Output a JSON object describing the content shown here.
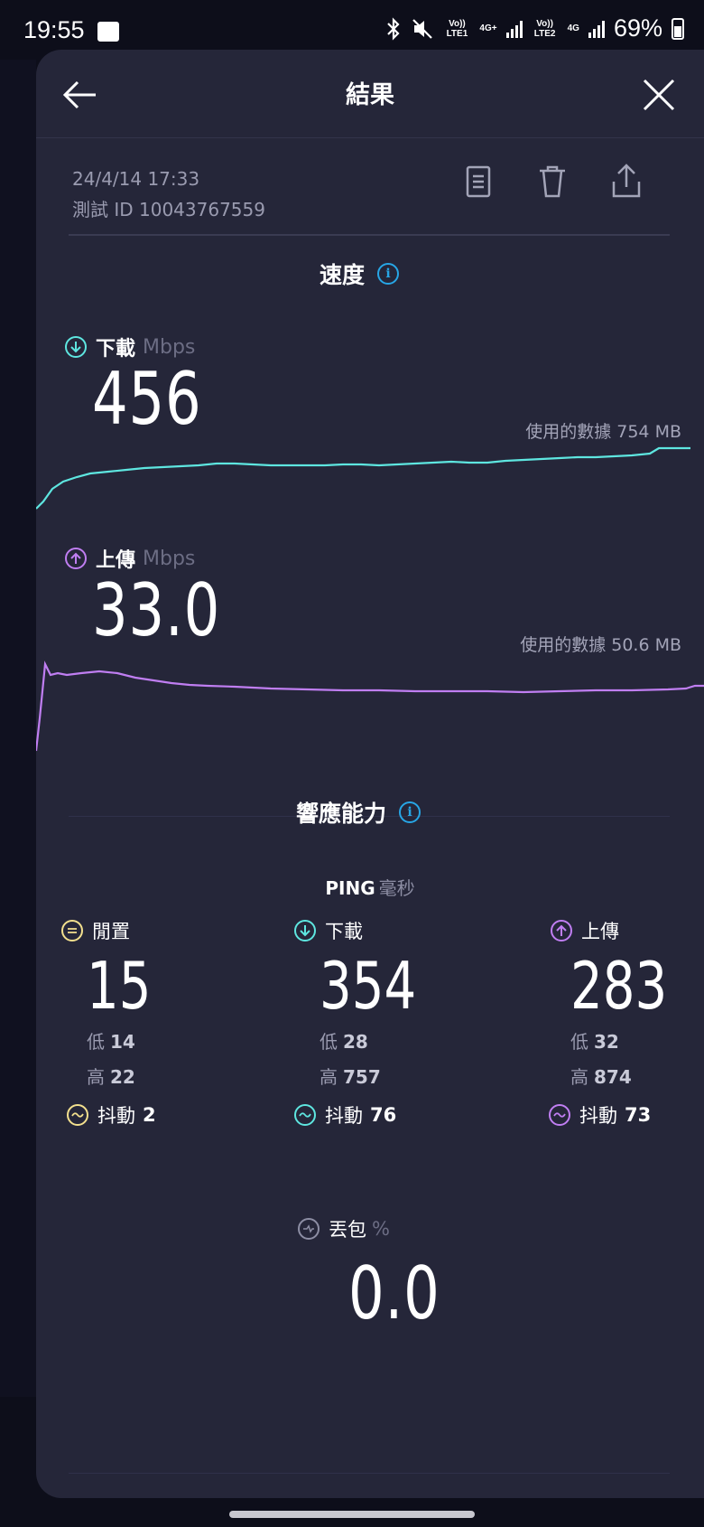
{
  "status_bar": {
    "time": "19:55",
    "network1_label": "Vo)) LTE1",
    "network1_type": "4G+",
    "network2_label": "Vo)) LTE2",
    "network2_type": "4G",
    "battery": "69%"
  },
  "header": {
    "title": "結果"
  },
  "meta": {
    "date": "24/4/14 17:33",
    "test_id": "測試 ID 10043767559"
  },
  "speed": {
    "title": "速度",
    "download": {
      "label": "下載",
      "unit": "Mbps",
      "value": "456",
      "data_used": "使用的數據 754 MB",
      "color": "#5ee6e0"
    },
    "upload": {
      "label": "上傳",
      "unit": "Mbps",
      "value": "33.0",
      "data_used": "使用的數據 50.6 MB",
      "color": "#c07ef2"
    }
  },
  "responsiveness": {
    "title": "響應能力",
    "ping_label": "PING",
    "ping_unit": "毫秒",
    "columns": [
      {
        "label": "閒置",
        "value": "15",
        "low_label": "低",
        "low": "14",
        "high_label": "高",
        "high": "22",
        "jitter_label": "抖動",
        "jitter": "2",
        "color": "#f3e08e"
      },
      {
        "label": "下載",
        "value": "354",
        "low_label": "低",
        "low": "28",
        "high_label": "高",
        "high": "757",
        "jitter_label": "抖動",
        "jitter": "76",
        "color": "#5ee6e0"
      },
      {
        "label": "上傳",
        "value": "283",
        "low_label": "低",
        "low": "32",
        "high_label": "高",
        "high": "874",
        "jitter_label": "抖動",
        "jitter": "73",
        "color": "#c07ef2"
      }
    ]
  },
  "packet_loss": {
    "label": "丟包",
    "unit": "%",
    "value": "0.0"
  }
}
